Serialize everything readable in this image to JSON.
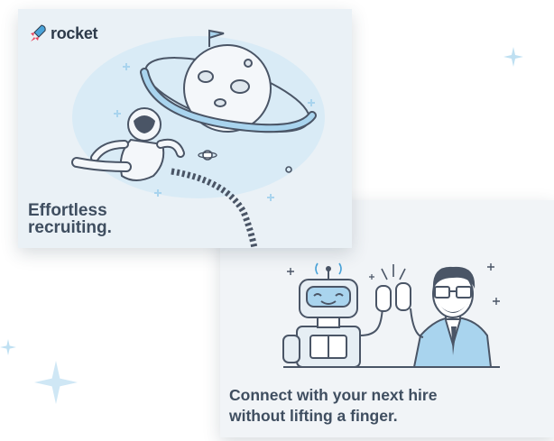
{
  "brand": {
    "logo_text": "rocket",
    "logo_icon": "rocket-icon"
  },
  "cards": {
    "top": {
      "line1": "Effortless",
      "line2": "recruiting."
    },
    "bottom": {
      "line1": "Connect with your next hire",
      "line2": "without lifting a finger."
    }
  },
  "colors": {
    "accent": "#e8425d",
    "rocket_blue": "#4aa3d9",
    "text": "#3f4e60",
    "sparkle": "#b7dbf0",
    "outline": "#4a5566"
  }
}
